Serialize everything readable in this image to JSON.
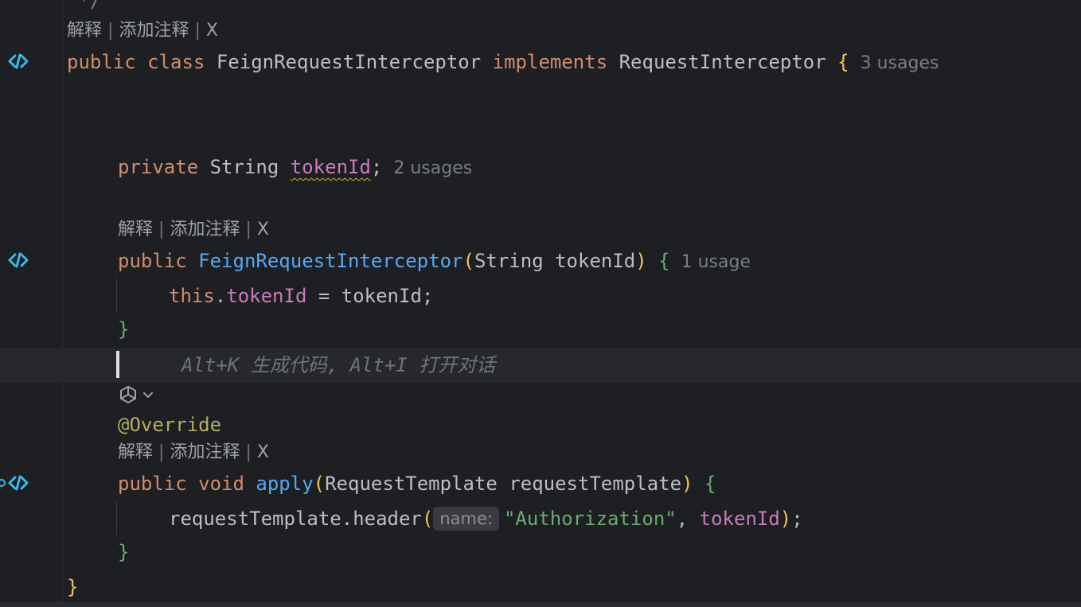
{
  "code_lens": {
    "explain": "解释",
    "sep": "|",
    "add_comment": "添加注释",
    "close": "X"
  },
  "lines": {
    "comment_end": " */",
    "class_decl": {
      "kw_public": "public",
      "kw_class": "class",
      "name": "FeignRequestInterceptor",
      "kw_implements": "implements",
      "iface": "RequestInterceptor",
      "brace": "{",
      "usages": "3 usages"
    },
    "field_decl": {
      "kw_private": "private",
      "type": "String",
      "name": "tokenId",
      "semi": ";",
      "usages": "2 usages"
    },
    "ctor_decl": {
      "kw_public": "public",
      "name": "FeignRequestInterceptor",
      "paren_open": "(",
      "param_type": "String",
      "param_name": "tokenId",
      "paren_close": ")",
      "brace": "{",
      "usages": "1 usage"
    },
    "ctor_body": {
      "kw_this": "this",
      "dot": ".",
      "field": "tokenId",
      "assign": " = tokenId;"
    },
    "ctor_close": "}",
    "ai_hint": "Alt+K 生成代码, Alt+I 打开对话",
    "annotation": "@Override",
    "apply_decl": {
      "kw_public": "public",
      "kw_void": "void",
      "name": "apply",
      "paren_open": "(",
      "param_type": "RequestTemplate",
      "param_name": "requestTemplate",
      "paren_close": ")",
      "brace": "{"
    },
    "apply_body": {
      "call": "requestTemplate.header",
      "paren_open": "(",
      "hint": "name:",
      "str": "\"Authorization\"",
      "comma": ", ",
      "field": "tokenId",
      "paren_close": ")",
      "semi": ";"
    },
    "apply_close": "}",
    "class_close": "}"
  },
  "icons": {
    "gutter": "implementation-gutter-icon",
    "ai": "ai-assistant-icon",
    "chevron": "chevron-down-icon"
  },
  "colors": {
    "background": "#1e1f22",
    "keyword": "#cf8e6d",
    "function": "#56a8f5",
    "field": "#c77dbb",
    "string": "#6aab73",
    "annotation": "#b3ae60",
    "gutter_icon": "#3ab8e8"
  }
}
